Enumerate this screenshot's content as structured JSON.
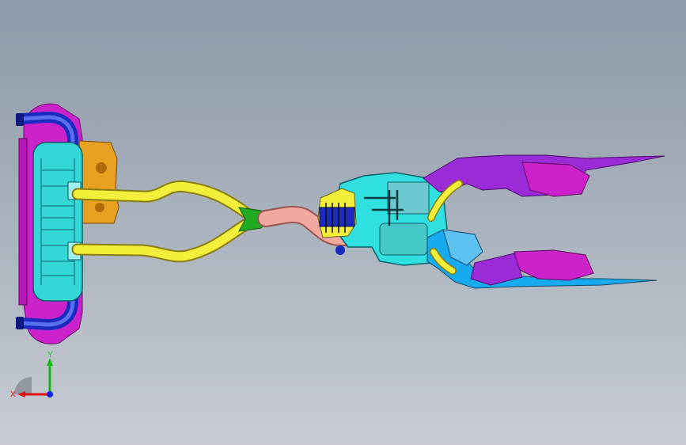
{
  "view": {
    "background_top": "#8d99a7",
    "background_bottom": "#c8ccd2"
  },
  "model": {
    "kind": "exhaust-system-assembly",
    "part_colors": {
      "muffler": "#35d6d6",
      "heat-shield": "#cc22cc",
      "tail-pipes": "#2233cc",
      "bracket": "#e8a020",
      "twin-pipes": "#f2ee3a",
      "y-joint": "#22aa22",
      "mid-pipe": "#f0a8a0",
      "cat-converter": "#30e0e0",
      "front-frame": "#9b2bd6",
      "front-cross-member": "#18aaee"
    }
  },
  "triad": {
    "x_label": "X",
    "y_label": "Y",
    "x_color": "#dd1111",
    "y_color": "#11bb11",
    "z_color": "#1122dd"
  }
}
